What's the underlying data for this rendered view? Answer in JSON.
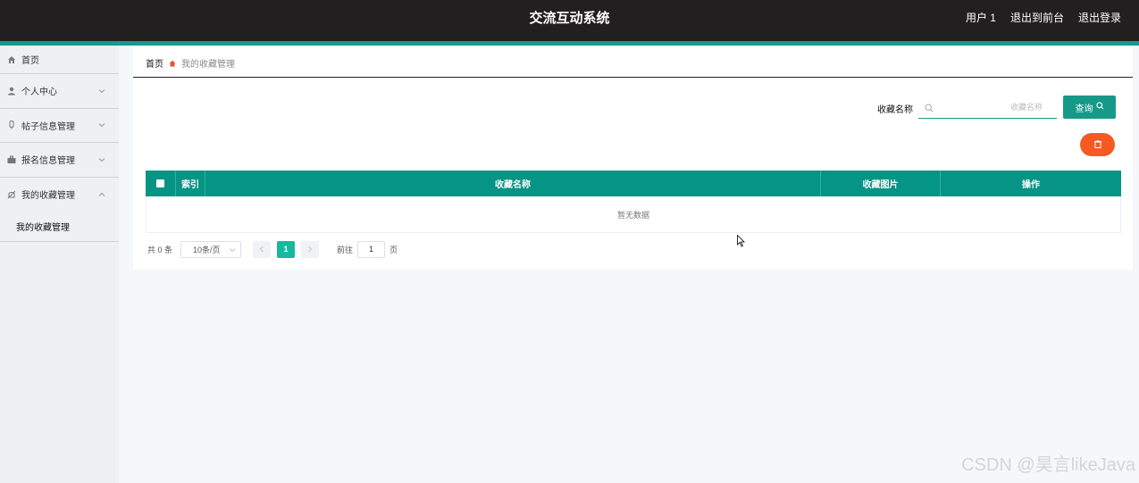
{
  "header": {
    "title": "交流互动系统",
    "user": "用户 1",
    "to_front": "退出到前台",
    "logout": "退出登录"
  },
  "sidebar": {
    "items": [
      {
        "label": "首页",
        "icon": "home-icon"
      },
      {
        "label": "个人中心",
        "icon": "user-icon"
      },
      {
        "label": "帖子信息管理",
        "icon": "post-icon"
      },
      {
        "label": "报名信息管理",
        "icon": "briefcase-icon"
      },
      {
        "label": "我的收藏管理",
        "icon": "favorite-icon"
      }
    ],
    "sub_item": "我的收藏管理"
  },
  "breadcrumb": {
    "home": "首页",
    "current": "我的收藏管理"
  },
  "search": {
    "label": "收藏名称",
    "placeholder": "收藏名称",
    "value": "",
    "button": "查询"
  },
  "table": {
    "columns": [
      "索引",
      "收藏名称",
      "收藏图片",
      "操作"
    ],
    "empty_text": "暂无数据"
  },
  "pagination": {
    "total": "共 0 条",
    "page_size": "10条/页",
    "current_page": "1",
    "goto_label": "前往",
    "goto_value": "1",
    "page_unit": "页"
  },
  "watermark": "CSDN @昊言likeJava",
  "colors": {
    "header_bg": "#221f21",
    "accent": "#17998a",
    "table_header": "#069485",
    "delete": "#f45a22",
    "active_page": "#15b99e"
  }
}
